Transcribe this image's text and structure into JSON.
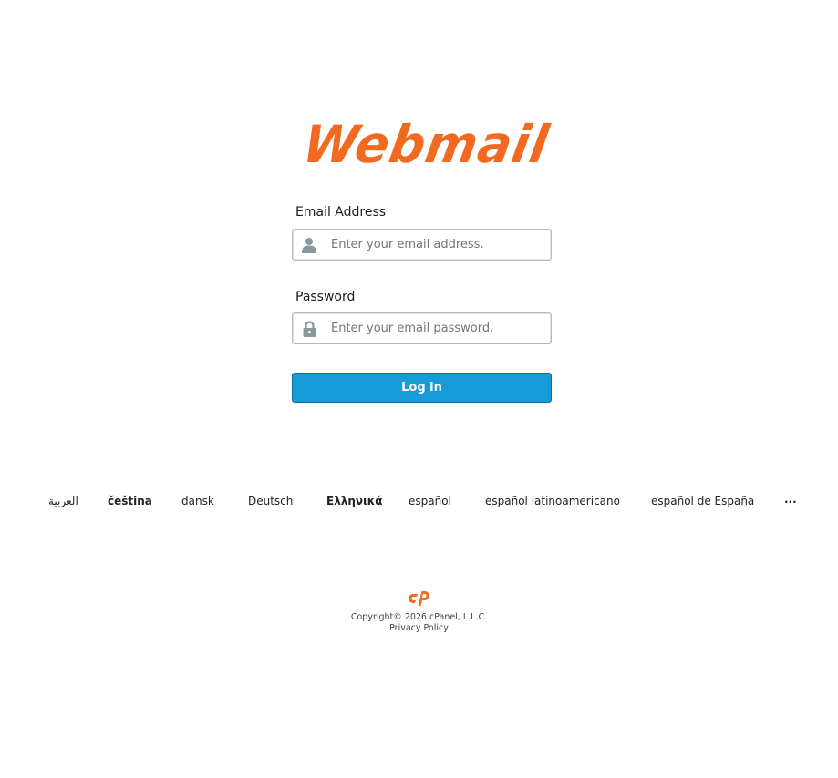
{
  "brand": {
    "logo_text": "Webmail",
    "accent_color": "#f26a21"
  },
  "form": {
    "email": {
      "label": "Email Address",
      "placeholder": "Enter your email address.",
      "icon": "user-icon",
      "value": ""
    },
    "password": {
      "label": "Password",
      "placeholder": "Enter your email password.",
      "icon": "lock-icon",
      "value": ""
    },
    "login_label": "Log in",
    "button_color": "#179bd7"
  },
  "languages": [
    "العربية",
    "čeština",
    "dansk",
    "Deutsch",
    "Ελληνικά",
    "español",
    "español latinoamericano",
    "español de España"
  ],
  "languages_more": "...",
  "footer": {
    "logo": "cpanel-logo",
    "copyright": "Copyright© 2026 cPanel, L.L.C.",
    "privacy": "Privacy Policy"
  }
}
